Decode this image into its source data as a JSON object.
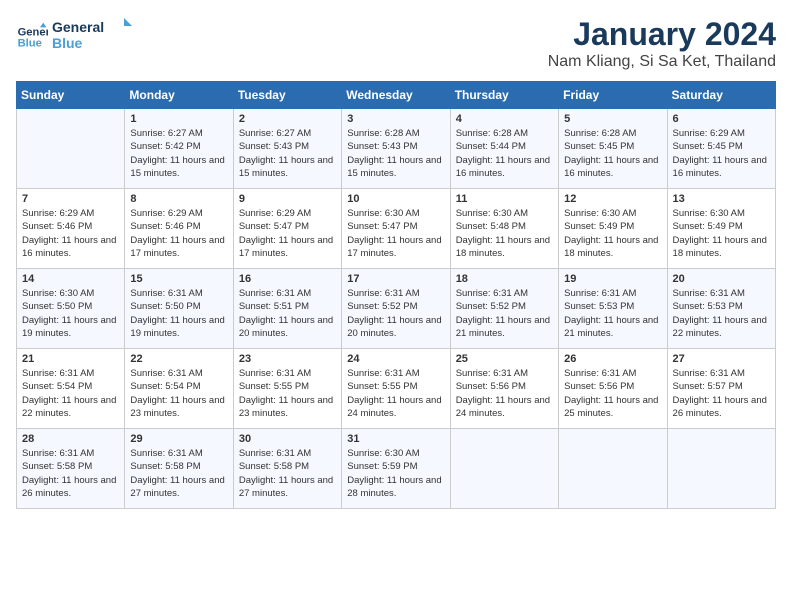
{
  "logo": {
    "line1": "General",
    "line2": "Blue"
  },
  "title": "January 2024",
  "location": "Nam Kliang, Si Sa Ket, Thailand",
  "days_of_week": [
    "Sunday",
    "Monday",
    "Tuesday",
    "Wednesday",
    "Thursday",
    "Friday",
    "Saturday"
  ],
  "weeks": [
    [
      {
        "day": "",
        "sunrise": "",
        "sunset": "",
        "daylight": ""
      },
      {
        "day": "1",
        "sunrise": "Sunrise: 6:27 AM",
        "sunset": "Sunset: 5:42 PM",
        "daylight": "Daylight: 11 hours and 15 minutes."
      },
      {
        "day": "2",
        "sunrise": "Sunrise: 6:27 AM",
        "sunset": "Sunset: 5:43 PM",
        "daylight": "Daylight: 11 hours and 15 minutes."
      },
      {
        "day": "3",
        "sunrise": "Sunrise: 6:28 AM",
        "sunset": "Sunset: 5:43 PM",
        "daylight": "Daylight: 11 hours and 15 minutes."
      },
      {
        "day": "4",
        "sunrise": "Sunrise: 6:28 AM",
        "sunset": "Sunset: 5:44 PM",
        "daylight": "Daylight: 11 hours and 16 minutes."
      },
      {
        "day": "5",
        "sunrise": "Sunrise: 6:28 AM",
        "sunset": "Sunset: 5:45 PM",
        "daylight": "Daylight: 11 hours and 16 minutes."
      },
      {
        "day": "6",
        "sunrise": "Sunrise: 6:29 AM",
        "sunset": "Sunset: 5:45 PM",
        "daylight": "Daylight: 11 hours and 16 minutes."
      }
    ],
    [
      {
        "day": "7",
        "sunrise": "Sunrise: 6:29 AM",
        "sunset": "Sunset: 5:46 PM",
        "daylight": "Daylight: 11 hours and 16 minutes."
      },
      {
        "day": "8",
        "sunrise": "Sunrise: 6:29 AM",
        "sunset": "Sunset: 5:46 PM",
        "daylight": "Daylight: 11 hours and 17 minutes."
      },
      {
        "day": "9",
        "sunrise": "Sunrise: 6:29 AM",
        "sunset": "Sunset: 5:47 PM",
        "daylight": "Daylight: 11 hours and 17 minutes."
      },
      {
        "day": "10",
        "sunrise": "Sunrise: 6:30 AM",
        "sunset": "Sunset: 5:47 PM",
        "daylight": "Daylight: 11 hours and 17 minutes."
      },
      {
        "day": "11",
        "sunrise": "Sunrise: 6:30 AM",
        "sunset": "Sunset: 5:48 PM",
        "daylight": "Daylight: 11 hours and 18 minutes."
      },
      {
        "day": "12",
        "sunrise": "Sunrise: 6:30 AM",
        "sunset": "Sunset: 5:49 PM",
        "daylight": "Daylight: 11 hours and 18 minutes."
      },
      {
        "day": "13",
        "sunrise": "Sunrise: 6:30 AM",
        "sunset": "Sunset: 5:49 PM",
        "daylight": "Daylight: 11 hours and 18 minutes."
      }
    ],
    [
      {
        "day": "14",
        "sunrise": "Sunrise: 6:30 AM",
        "sunset": "Sunset: 5:50 PM",
        "daylight": "Daylight: 11 hours and 19 minutes."
      },
      {
        "day": "15",
        "sunrise": "Sunrise: 6:31 AM",
        "sunset": "Sunset: 5:50 PM",
        "daylight": "Daylight: 11 hours and 19 minutes."
      },
      {
        "day": "16",
        "sunrise": "Sunrise: 6:31 AM",
        "sunset": "Sunset: 5:51 PM",
        "daylight": "Daylight: 11 hours and 20 minutes."
      },
      {
        "day": "17",
        "sunrise": "Sunrise: 6:31 AM",
        "sunset": "Sunset: 5:52 PM",
        "daylight": "Daylight: 11 hours and 20 minutes."
      },
      {
        "day": "18",
        "sunrise": "Sunrise: 6:31 AM",
        "sunset": "Sunset: 5:52 PM",
        "daylight": "Daylight: 11 hours and 21 minutes."
      },
      {
        "day": "19",
        "sunrise": "Sunrise: 6:31 AM",
        "sunset": "Sunset: 5:53 PM",
        "daylight": "Daylight: 11 hours and 21 minutes."
      },
      {
        "day": "20",
        "sunrise": "Sunrise: 6:31 AM",
        "sunset": "Sunset: 5:53 PM",
        "daylight": "Daylight: 11 hours and 22 minutes."
      }
    ],
    [
      {
        "day": "21",
        "sunrise": "Sunrise: 6:31 AM",
        "sunset": "Sunset: 5:54 PM",
        "daylight": "Daylight: 11 hours and 22 minutes."
      },
      {
        "day": "22",
        "sunrise": "Sunrise: 6:31 AM",
        "sunset": "Sunset: 5:54 PM",
        "daylight": "Daylight: 11 hours and 23 minutes."
      },
      {
        "day": "23",
        "sunrise": "Sunrise: 6:31 AM",
        "sunset": "Sunset: 5:55 PM",
        "daylight": "Daylight: 11 hours and 23 minutes."
      },
      {
        "day": "24",
        "sunrise": "Sunrise: 6:31 AM",
        "sunset": "Sunset: 5:55 PM",
        "daylight": "Daylight: 11 hours and 24 minutes."
      },
      {
        "day": "25",
        "sunrise": "Sunrise: 6:31 AM",
        "sunset": "Sunset: 5:56 PM",
        "daylight": "Daylight: 11 hours and 24 minutes."
      },
      {
        "day": "26",
        "sunrise": "Sunrise: 6:31 AM",
        "sunset": "Sunset: 5:56 PM",
        "daylight": "Daylight: 11 hours and 25 minutes."
      },
      {
        "day": "27",
        "sunrise": "Sunrise: 6:31 AM",
        "sunset": "Sunset: 5:57 PM",
        "daylight": "Daylight: 11 hours and 26 minutes."
      }
    ],
    [
      {
        "day": "28",
        "sunrise": "Sunrise: 6:31 AM",
        "sunset": "Sunset: 5:58 PM",
        "daylight": "Daylight: 11 hours and 26 minutes."
      },
      {
        "day": "29",
        "sunrise": "Sunrise: 6:31 AM",
        "sunset": "Sunset: 5:58 PM",
        "daylight": "Daylight: 11 hours and 27 minutes."
      },
      {
        "day": "30",
        "sunrise": "Sunrise: 6:31 AM",
        "sunset": "Sunset: 5:58 PM",
        "daylight": "Daylight: 11 hours and 27 minutes."
      },
      {
        "day": "31",
        "sunrise": "Sunrise: 6:30 AM",
        "sunset": "Sunset: 5:59 PM",
        "daylight": "Daylight: 11 hours and 28 minutes."
      },
      {
        "day": "",
        "sunrise": "",
        "sunset": "",
        "daylight": ""
      },
      {
        "day": "",
        "sunrise": "",
        "sunset": "",
        "daylight": ""
      },
      {
        "day": "",
        "sunrise": "",
        "sunset": "",
        "daylight": ""
      }
    ]
  ]
}
